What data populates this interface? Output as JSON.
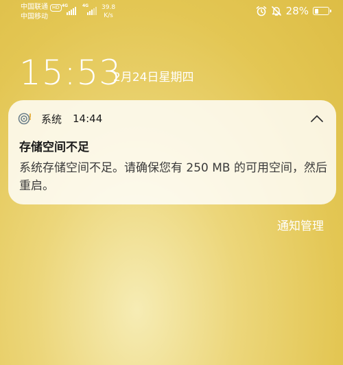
{
  "status_bar": {
    "carrier_1": "中国联通",
    "carrier_1_badge": "HD",
    "carrier_2": "中国移动",
    "signal_1_tag": "4G",
    "signal_2_tag": "4G",
    "speed_value": "39.8",
    "speed_unit": "K/s",
    "battery_text": "28%",
    "battery_level": 0.28,
    "icons": [
      "alarm-icon",
      "mute-icon",
      "battery-icon"
    ]
  },
  "lockscreen": {
    "time": "15:53",
    "date": "2月24日星期四"
  },
  "notification": {
    "app_name": "系统",
    "time": "14:44",
    "title": "存储空间不足",
    "body": "系统存储空间不足。请确保您有 250 MB 的可用空间，然后重启。"
  },
  "manage_link": "通知管理"
}
